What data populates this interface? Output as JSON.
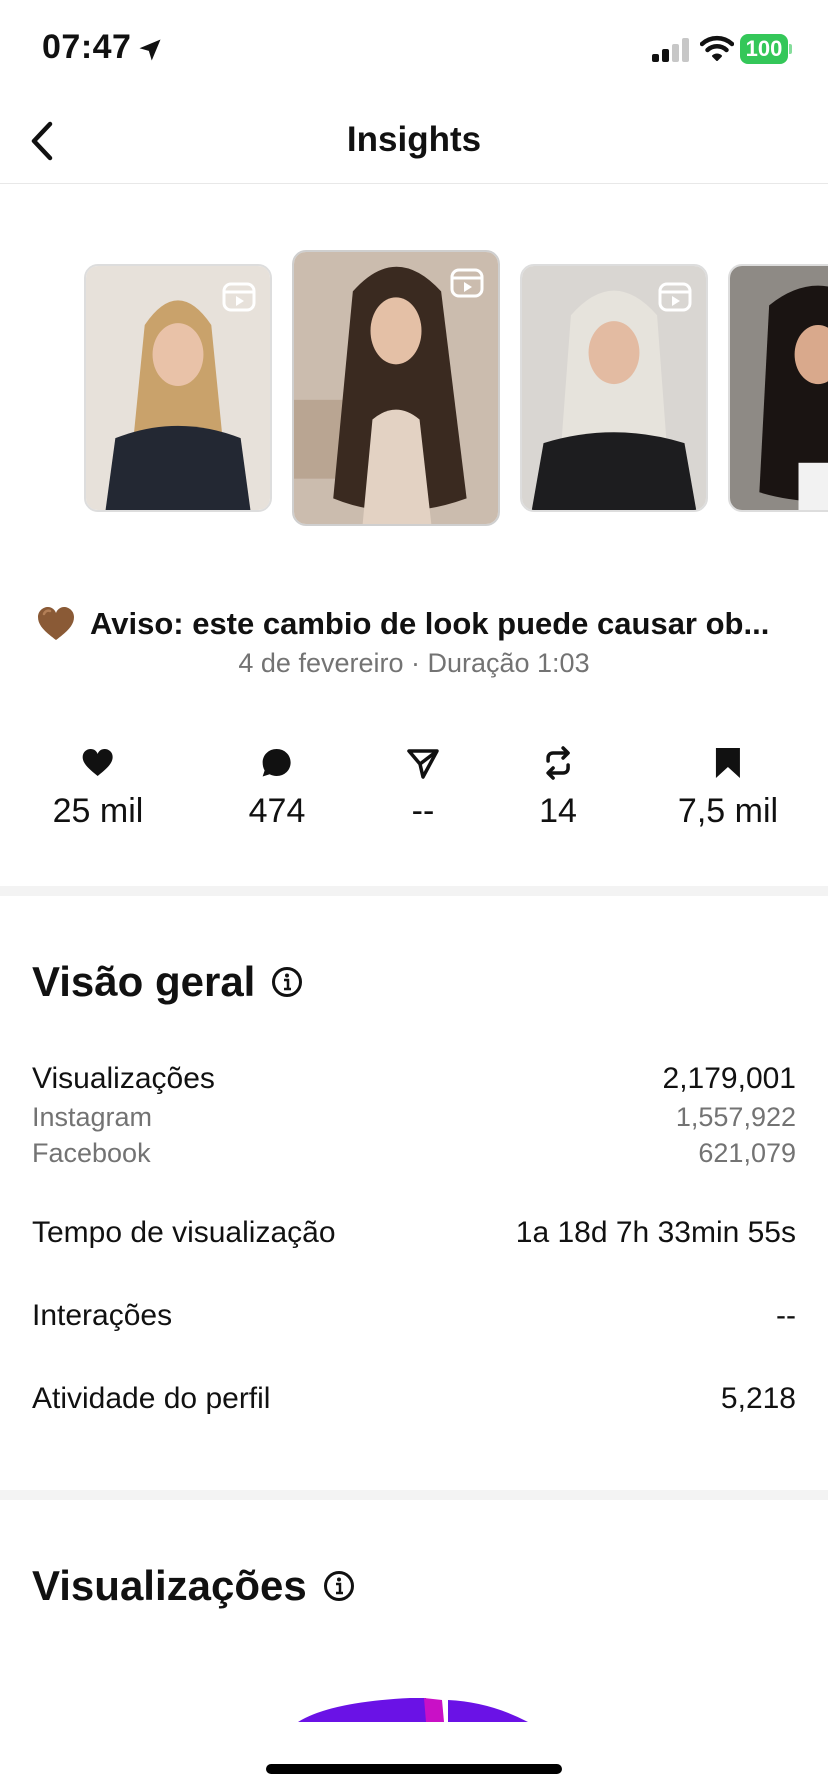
{
  "status_bar": {
    "time": "07:47",
    "battery": "100"
  },
  "header": {
    "title": "Insights"
  },
  "thumbnails": [
    {
      "name": "reel-thumb-1"
    },
    {
      "name": "reel-thumb-2",
      "selected": true
    },
    {
      "name": "reel-thumb-3"
    },
    {
      "name": "reel-thumb-4"
    }
  ],
  "post": {
    "caption": "Aviso: este cambio de look puede causar ob...",
    "meta": "4 de fevereiro · Duração 1:03"
  },
  "stats": {
    "likes": "25 mil",
    "comments": "474",
    "shares": "--",
    "reposts": "14",
    "saves": "7,5 mil"
  },
  "overview": {
    "title": "Visão geral",
    "views_label": "Visualizações",
    "views_value": "2,179,001",
    "instagram_label": "Instagram",
    "instagram_value": "1,557,922",
    "facebook_label": "Facebook",
    "facebook_value": "621,079",
    "watch_time_label": "Tempo de visualização",
    "watch_time_value": "1a 18d 7h 33min 55s",
    "interactions_label": "Interações",
    "interactions_value": "--",
    "profile_activity_label": "Atividade do perfil",
    "profile_activity_value": "5,218"
  },
  "views_section": {
    "title": "Visualizações"
  },
  "colors": {
    "accent_purple": "#6a12e6",
    "accent_magenta": "#c910c6",
    "battery_green": "#34c759",
    "muted_text": "#737373"
  }
}
